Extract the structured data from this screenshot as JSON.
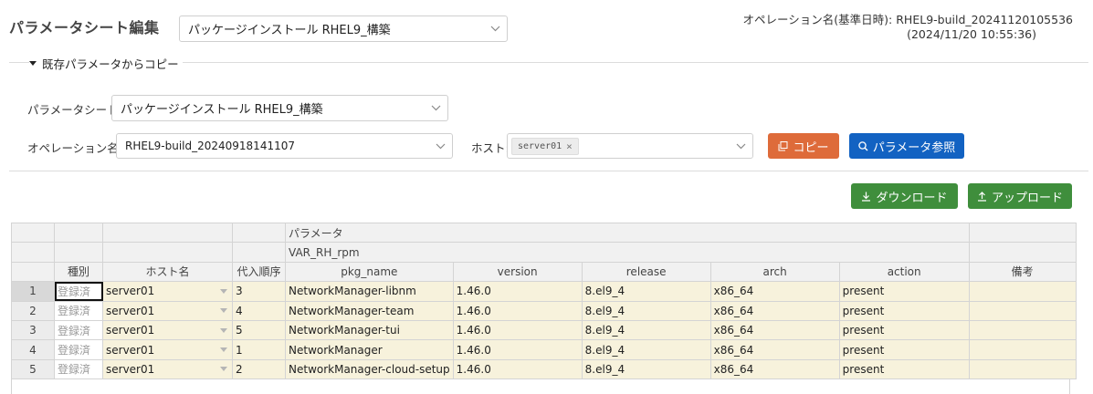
{
  "page": {
    "title": "パラメータシート編集"
  },
  "sheet_select": {
    "value": "パッケージインストール RHEL9_構築"
  },
  "operation_info": {
    "label": "オペレーション名(基準日時):",
    "name": "RHEL9-build_20241120105536",
    "datetime": "(2024/11/20 10:55:36)"
  },
  "copy_section": {
    "legend": "既存パラメータからコピー",
    "sheet_label": "パラメータシート:",
    "sheet_value": "パッケージインストール RHEL9_構築",
    "operation_label": "オペレーション名:",
    "operation_value": "RHEL9-build_20240918141107",
    "host_label": "ホスト:",
    "host_tag": "server01",
    "copy_button": "コピー",
    "reference_button": "パラメータ参照"
  },
  "actions": {
    "download": "ダウンロード",
    "upload": "アップロード"
  },
  "table": {
    "group_header": "パラメータ",
    "subgroup_header": "VAR_RH_rpm",
    "columns": [
      "",
      "種別",
      "ホスト名",
      "代入順序",
      "pkg_name",
      "version",
      "release",
      "arch",
      "action",
      "備考"
    ],
    "rows": [
      {
        "no": "1",
        "kind": "登録済",
        "host": "server01",
        "order": "3",
        "pkg_name": "NetworkManager-libnm",
        "version": "1.46.0",
        "release": "8.el9_4",
        "arch": "x86_64",
        "action": "present",
        "note": ""
      },
      {
        "no": "2",
        "kind": "登録済",
        "host": "server01",
        "order": "4",
        "pkg_name": "NetworkManager-team",
        "version": "1.46.0",
        "release": "8.el9_4",
        "arch": "x86_64",
        "action": "present",
        "note": ""
      },
      {
        "no": "3",
        "kind": "登録済",
        "host": "server01",
        "order": "5",
        "pkg_name": "NetworkManager-tui",
        "version": "1.46.0",
        "release": "8.el9_4",
        "arch": "x86_64",
        "action": "present",
        "note": ""
      },
      {
        "no": "4",
        "kind": "登録済",
        "host": "server01",
        "order": "1",
        "pkg_name": "NetworkManager",
        "version": "1.46.0",
        "release": "8.el9_4",
        "arch": "x86_64",
        "action": "present",
        "note": ""
      },
      {
        "no": "5",
        "kind": "登録済",
        "host": "server01",
        "order": "2",
        "pkg_name": "NetworkManager-cloud-setup",
        "version": "1.46.0",
        "release": "8.el9_4",
        "arch": "x86_64",
        "action": "present",
        "note": ""
      }
    ]
  },
  "colors": {
    "copy": "#de6b3a",
    "reference": "#1262c2",
    "green": "#3f8e3c",
    "row_bg": "#f7f2dc"
  }
}
